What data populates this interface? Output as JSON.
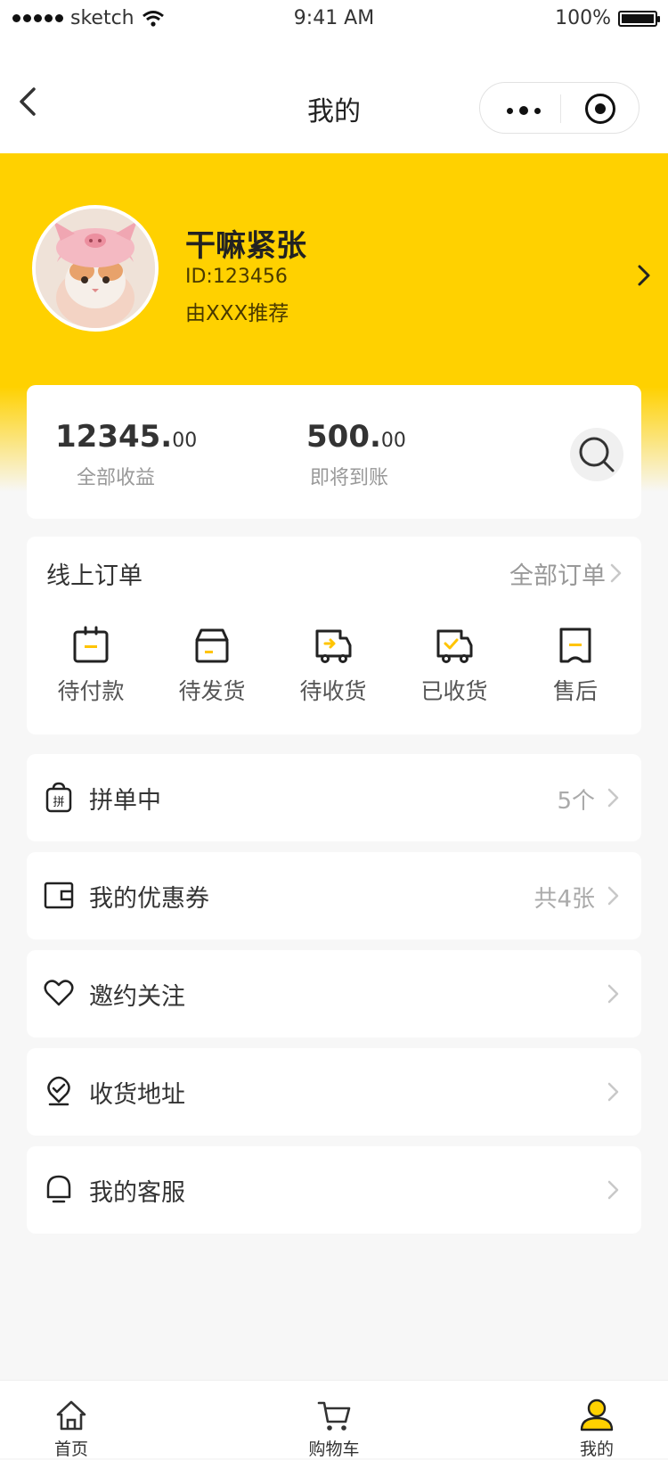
{
  "status_bar": {
    "carrier": "sketch",
    "time": "9:41 AM",
    "battery": "100%"
  },
  "nav": {
    "title": "我的"
  },
  "profile": {
    "name": "干嘛紧张",
    "id": "ID:123456",
    "referrer": "由XXX推荐"
  },
  "earnings": {
    "total": {
      "integer": "12345.",
      "decimals": "00",
      "label": "全部收益"
    },
    "pending": {
      "integer": "500.",
      "decimals": "00",
      "label": "即将到账"
    }
  },
  "orders": {
    "title": "线上订单",
    "all_label": "全部订单",
    "items": [
      {
        "label": "待付款",
        "icon": "pending-payment-icon"
      },
      {
        "label": "待发货",
        "icon": "pending-shipment-icon"
      },
      {
        "label": "待收货",
        "icon": "pending-receipt-icon"
      },
      {
        "label": "已收货",
        "icon": "received-icon"
      },
      {
        "label": "售后",
        "icon": "after-sales-icon"
      }
    ]
  },
  "menu": [
    {
      "label": "拼单中",
      "value": "5个",
      "icon": "group-buy-icon"
    },
    {
      "label": "我的优惠券",
      "value": "共4张",
      "icon": "coupon-wallet-icon"
    },
    {
      "label": "邀约关注",
      "value": "",
      "icon": "heart-icon"
    },
    {
      "label": "收货地址",
      "value": "",
      "icon": "location-pin-icon"
    },
    {
      "label": "我的客服",
      "value": "",
      "icon": "customer-service-icon"
    }
  ],
  "tabbar": [
    {
      "label": "首页",
      "icon": "home-icon"
    },
    {
      "label": "购物车",
      "icon": "cart-icon"
    },
    {
      "label": "我的",
      "icon": "user-icon"
    }
  ],
  "colors": {
    "accent": "#ffd100",
    "text": "#333333",
    "muted": "#999999",
    "background": "#f7f7f7"
  }
}
